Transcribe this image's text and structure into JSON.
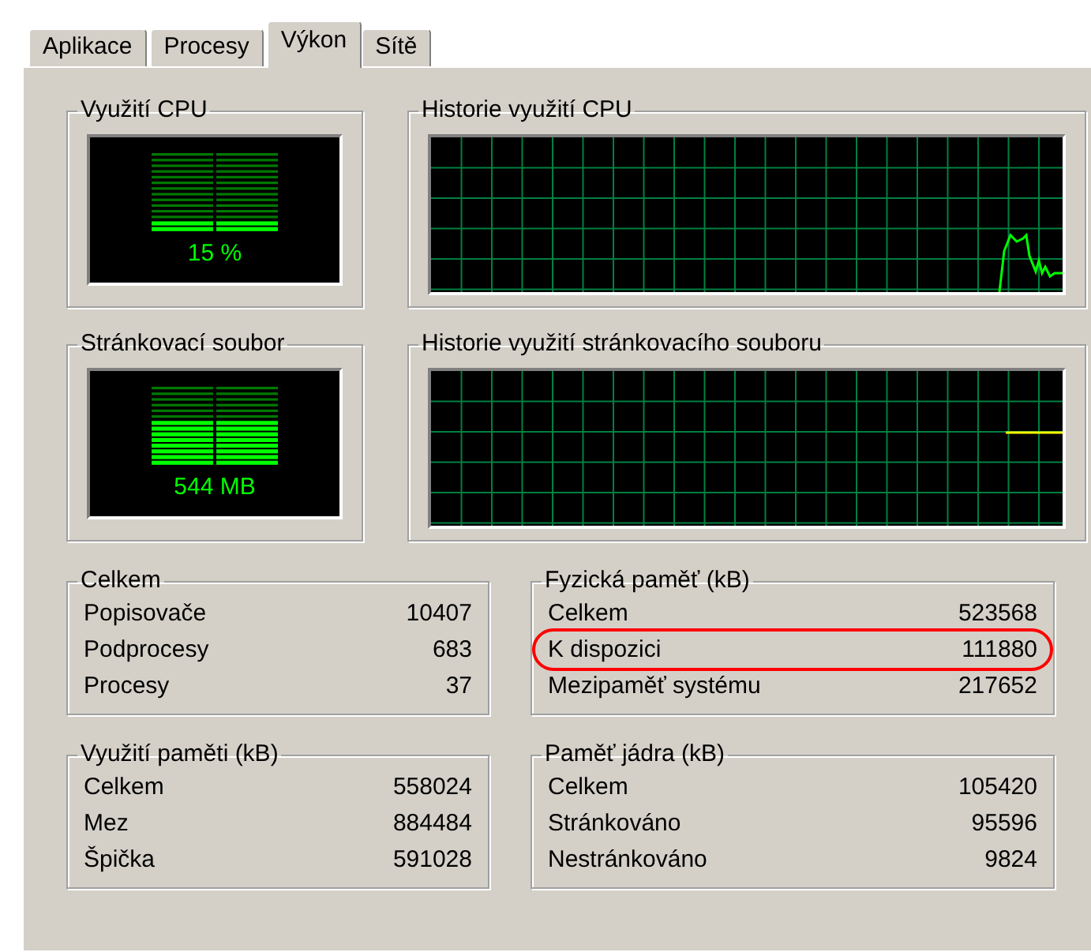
{
  "tabs": [
    {
      "label": "Aplikace",
      "selected": false
    },
    {
      "label": "Procesy",
      "selected": false
    },
    {
      "label": "Výkon",
      "selected": true
    },
    {
      "label": "Sítě",
      "selected": false
    }
  ],
  "gauges": [
    {
      "title": "Využití CPU",
      "reading": "15 %",
      "level": 0.15
    },
    {
      "title": "Stránkovací soubor",
      "reading": "544 MB",
      "level": 0.6
    }
  ],
  "histories": [
    {
      "title": "Historie využití CPU",
      "kind": "cpu"
    },
    {
      "title": "Historie využití stránkovacího souboru",
      "kind": "pagefile"
    }
  ],
  "stat_groups": [
    {
      "title": "Celkem",
      "rows": [
        {
          "label": "Popisovače",
          "value": "10407",
          "circled": false
        },
        {
          "label": "Podprocesy",
          "value": "683",
          "circled": false
        },
        {
          "label": "Procesy",
          "value": "37",
          "circled": false
        }
      ]
    },
    {
      "title": "Fyzická paměť (kB)",
      "rows": [
        {
          "label": "Celkem",
          "value": "523568",
          "circled": false
        },
        {
          "label": "K dispozici",
          "value": "111880",
          "circled": true
        },
        {
          "label": "Mezipaměť systému",
          "value": "217652",
          "circled": false
        }
      ]
    },
    {
      "title": "Využití paměti (kB)",
      "rows": [
        {
          "label": "Celkem",
          "value": "558024",
          "circled": false
        },
        {
          "label": "Mez",
          "value": "884484",
          "circled": false
        },
        {
          "label": "Špička",
          "value": "591028",
          "circled": false
        }
      ]
    },
    {
      "title": "Paměť jádra (kB)",
      "rows": [
        {
          "label": "Celkem",
          "value": "105420",
          "circled": false
        },
        {
          "label": "Stránkováno",
          "value": "95596",
          "circled": false
        },
        {
          "label": "Nestránkováno",
          "value": "9824",
          "circled": false
        }
      ]
    }
  ]
}
